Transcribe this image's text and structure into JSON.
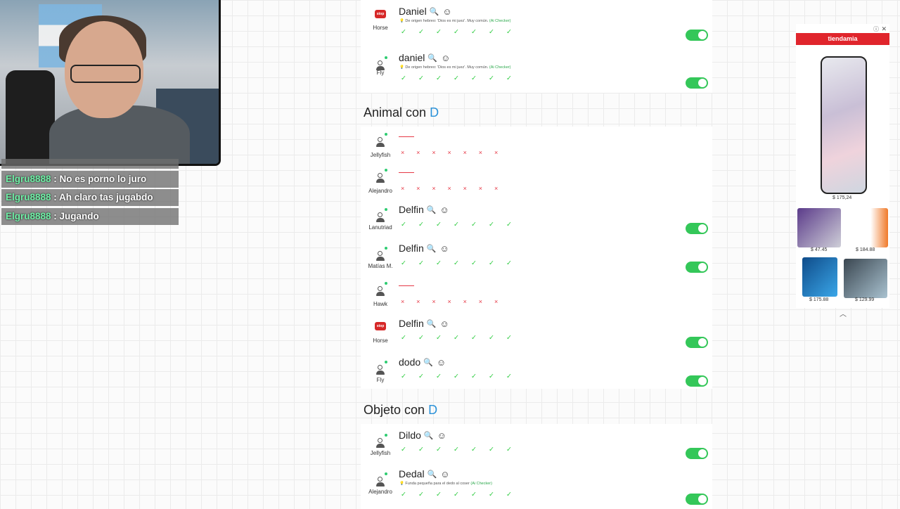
{
  "chat": {
    "messages": [
      {
        "user": "Elgru8888",
        "text": "No es porno lo juro"
      },
      {
        "user": "Elgru8888",
        "text": "Ah claro tas jugabdo"
      },
      {
        "user": "Elgru8888",
        "text": "Jugando"
      }
    ],
    "separator": " : "
  },
  "top_answers": [
    {
      "player": "Horse",
      "avatar": "brand",
      "word": "Daniel",
      "definition": "De origen hebreo: 'Dios es mi juez'. Muy común.",
      "ai_label": "(Ai Checker)",
      "valid": true
    },
    {
      "player": "Fly",
      "avatar": "person",
      "word": "daniel",
      "definition": "De origen hebreo: 'Dios es mi juez'. Muy común.",
      "ai_label": "(Ai Checker)",
      "valid": true
    }
  ],
  "categories": [
    {
      "title_prefix": "Animal con",
      "letter": "D",
      "answers": [
        {
          "player": "Jellyfish",
          "avatar": "person",
          "word": "",
          "valid": false
        },
        {
          "player": "Alejandro",
          "avatar": "person",
          "word": "",
          "valid": false
        },
        {
          "player": "Lanutriad",
          "avatar": "person",
          "word": "Delfin",
          "valid": true
        },
        {
          "player": "Matías M.",
          "avatar": "person-alt",
          "word": "Delfin",
          "valid": true
        },
        {
          "player": "Hawk",
          "avatar": "person",
          "word": "",
          "valid": false
        },
        {
          "player": "Horse",
          "avatar": "brand",
          "word": "Delfin",
          "valid": true
        },
        {
          "player": "Fly",
          "avatar": "person",
          "word": "dodo",
          "valid": true
        }
      ]
    },
    {
      "title_prefix": "Objeto con",
      "letter": "D",
      "answers": [
        {
          "player": "Jellyfish",
          "avatar": "person",
          "word": "Dildo",
          "valid": true
        },
        {
          "player": "Alejandro",
          "avatar": "person",
          "word": "Dedal",
          "definition": "Funda pequeña para el dedo al coser",
          "ai_label": "(Ai Checker)",
          "valid": true
        }
      ]
    }
  ],
  "marks": {
    "check": "✓ ✓ ✓ ✓ ✓ ✓ ✓",
    "cross": "× × × × × × ×"
  },
  "icons": {
    "search": "search-icon",
    "mood": "smiley-icon",
    "person": "person-icon"
  },
  "colors": {
    "accent_letter": "#2a91d8",
    "valid": "#2ecc40",
    "invalid": "#e63946",
    "toggle_on": "#34c759",
    "ad_brand": "#e0252c"
  },
  "ad": {
    "brand": "tiendamia",
    "prices": [
      "$ 175,24",
      "$ 47.45",
      "$ 184.88",
      "$ 175.88",
      "$ 129.99"
    ]
  }
}
